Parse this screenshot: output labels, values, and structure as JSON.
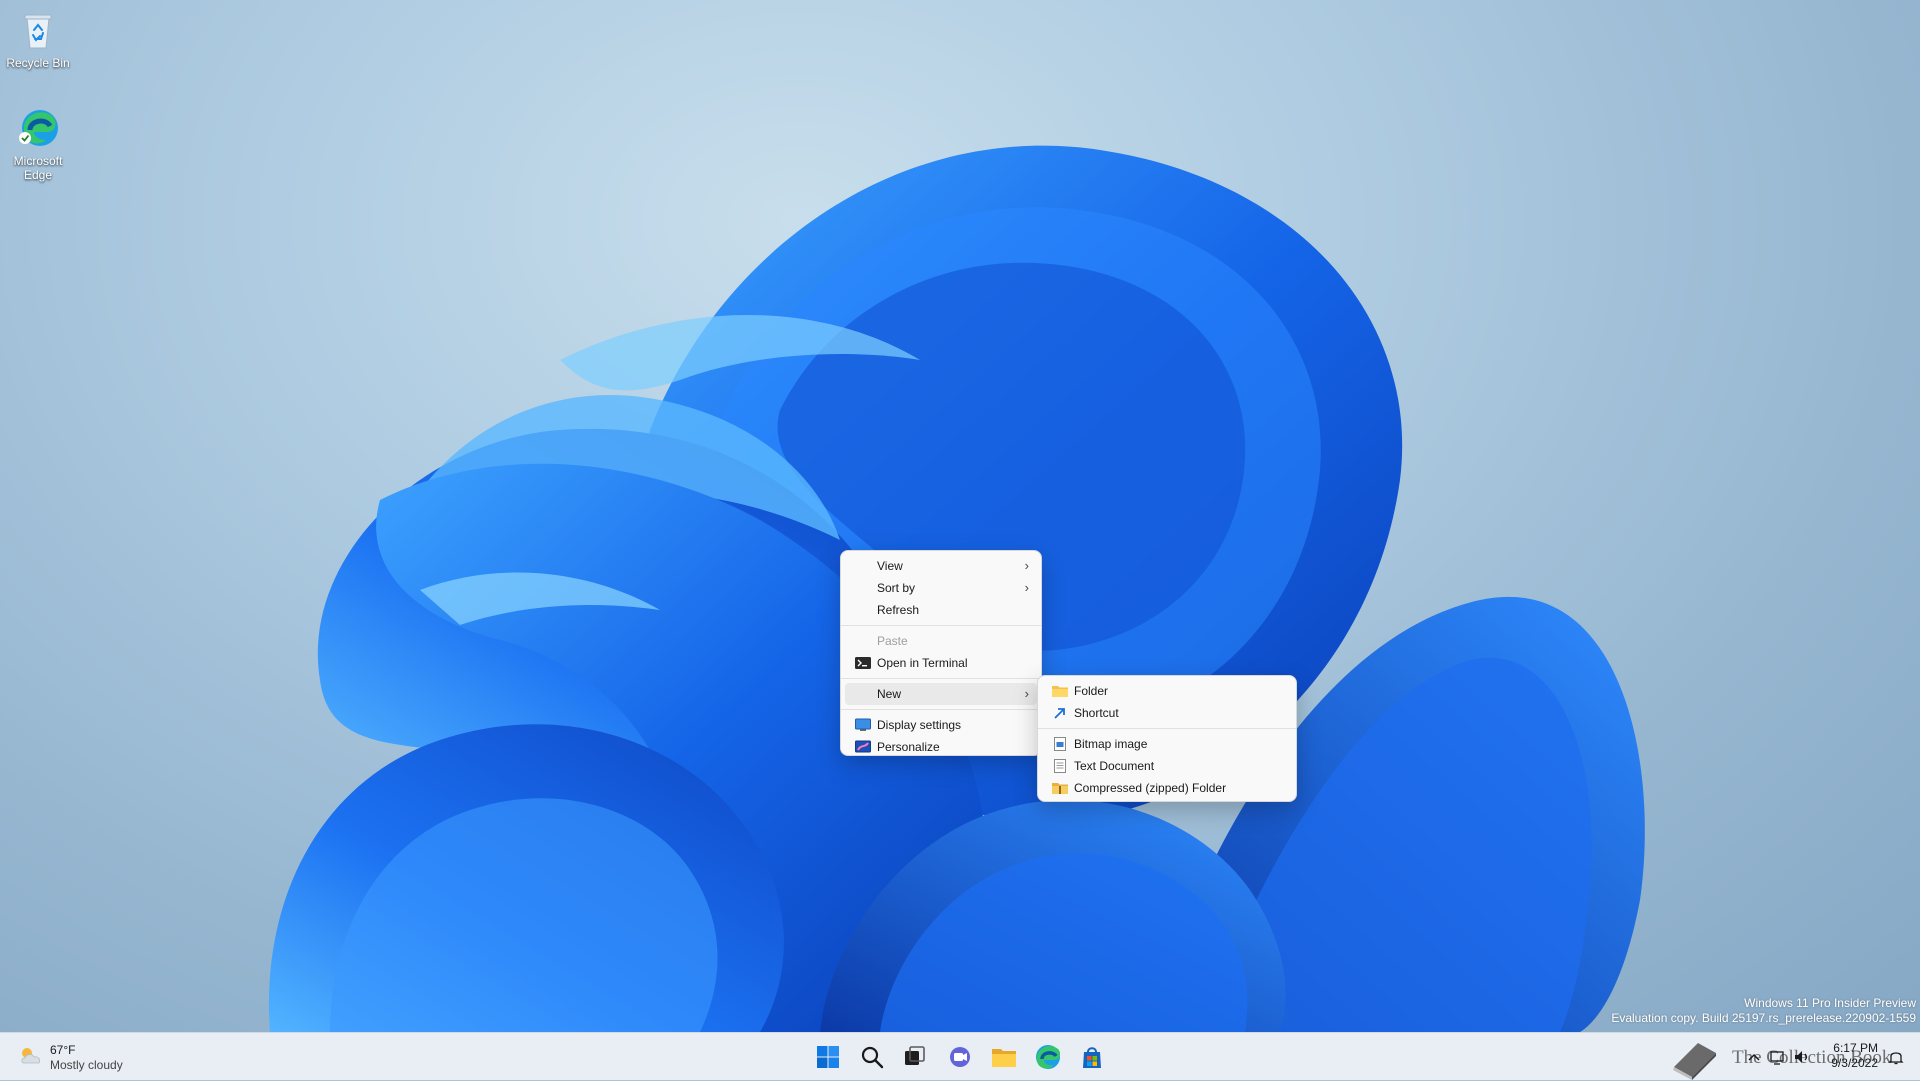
{
  "desktop_icons": [
    {
      "label": "Recycle Bin",
      "icon": "recycle-bin-icon"
    },
    {
      "label": "Microsoft Edge",
      "icon": "edge-icon"
    }
  ],
  "context_menu": {
    "items": {
      "view": "View",
      "sort_by": "Sort by",
      "refresh": "Refresh",
      "paste": "Paste",
      "open_terminal": "Open in Terminal",
      "new": "New",
      "display_settings": "Display settings",
      "personalize": "Personalize"
    }
  },
  "new_submenu": {
    "items": {
      "folder": "Folder",
      "shortcut": "Shortcut",
      "bitmap": "Bitmap image",
      "text_document": "Text Document",
      "compressed": "Compressed (zipped) Folder"
    }
  },
  "watermark": {
    "line1": "Windows 11 Pro Insider Preview",
    "line2": "Evaluation copy. Build 25197.rs_prerelease.220902-1559"
  },
  "taskbar": {
    "weather": {
      "temp": "67°F",
      "condition": "Mostly cloudy",
      "icon": "cloud-sun-icon"
    },
    "pinned": [
      "start-icon",
      "search-icon",
      "task-view-icon",
      "teams-chat-icon",
      "file-explorer-icon",
      "edge-icon",
      "store-icon"
    ],
    "tray": [
      "chevron-up-icon",
      "network-icon",
      "volume-icon",
      "notification-icon"
    ],
    "clock": {
      "time": "6:17 PM",
      "date": "9/3/2022"
    },
    "brand_text": "The Collection Book"
  },
  "colors": {
    "wallpaper_blue": "#1f6ff0",
    "menu_bg": "#f9f9f9",
    "taskbar_bg": "#e8eef4",
    "accent": "#0067c0"
  }
}
